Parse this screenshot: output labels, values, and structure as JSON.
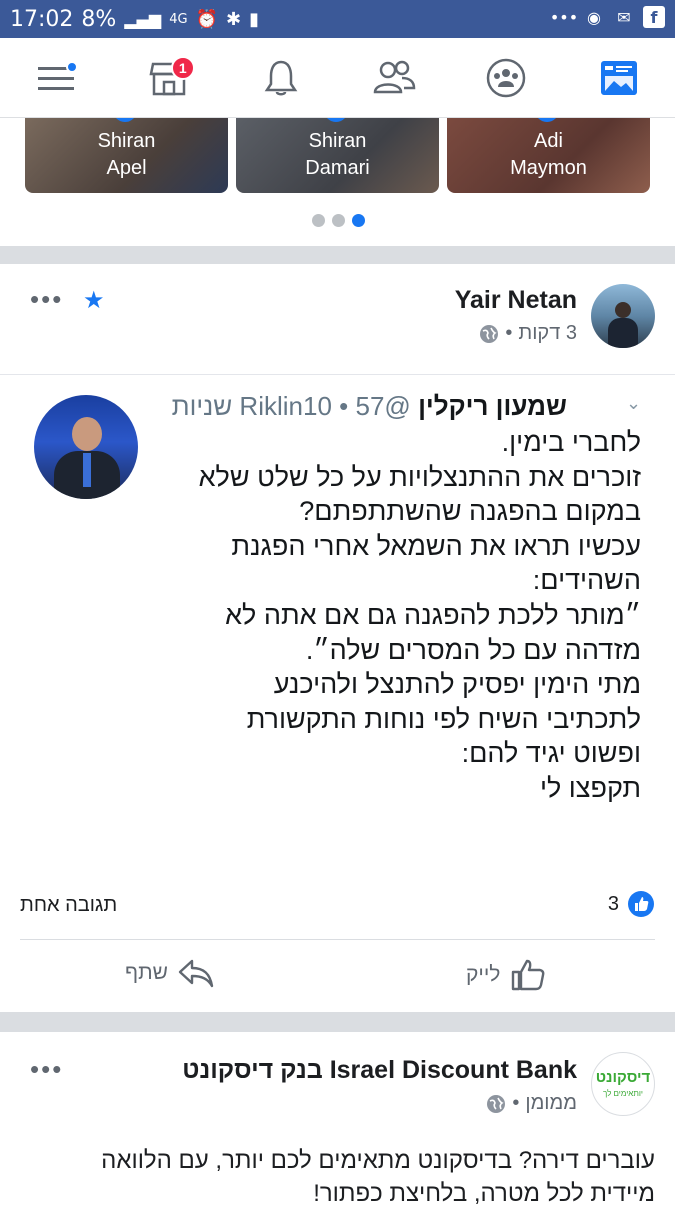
{
  "status_bar": {
    "time": "17:02",
    "battery": "8%",
    "network": "4G"
  },
  "nav": {
    "menu_icon": "menu-icon",
    "marketplace_badge": "1",
    "items": [
      "menu-icon",
      "marketplace-icon",
      "bell-icon",
      "friends-icon",
      "groups-icon",
      "news-feed-icon"
    ]
  },
  "stories": [
    {
      "first": "Shiran",
      "last": "Apel"
    },
    {
      "first": "Shiran",
      "last": "Damari"
    },
    {
      "first": "Adi",
      "last": "Maymon"
    }
  ],
  "post1": {
    "author": "Yair Netan",
    "time": "3 דקות",
    "dot": "•"
  },
  "tweet": {
    "display_name": "שמעון ריקלין",
    "handle": "@Riklin10",
    "age": "57 שניות",
    "dot": "•",
    "lines": [
      "לחברי בימין.",
      "זוכרים את ההתנצלויות על כל שלט שלא",
      "במקום בהפגנה שהשתתפתם?",
      "עכשיו תראו את השמאל אחרי הפגנת",
      "השהידים:",
      "״מותר ללכת להפגנה גם אם אתה לא",
      "מזדהה עם כל המסרים שלה״.",
      "מתי הימין יפסיק להתנצל ולהיכנע",
      "לתכתיבי השיח לפי נוחות התקשורת",
      "ופשוט יגיד להם:",
      "תקפצו לי"
    ]
  },
  "reactions": {
    "likes": "3",
    "comments": "תגובה אחת"
  },
  "actions": {
    "like": "לייק",
    "share": "שתף"
  },
  "post2": {
    "author": "Israel Discount Bank בנק דיסקונט",
    "sponsored": "ממומן",
    "dot": "•",
    "logo_text": "דיסקונט",
    "logo_sub": "יותאימים לך",
    "text_lines": [
      "עוברים דירה? בדיסקונט מתאימים לכם יותר, עם הלוואה",
      "מיידית לכל מטרה, בלחיצת כפתור!"
    ]
  },
  "colors": {
    "status_bar": "#3b5998",
    "accent": "#1877f2",
    "badge": "#f02849",
    "separator": "#dadde1"
  }
}
